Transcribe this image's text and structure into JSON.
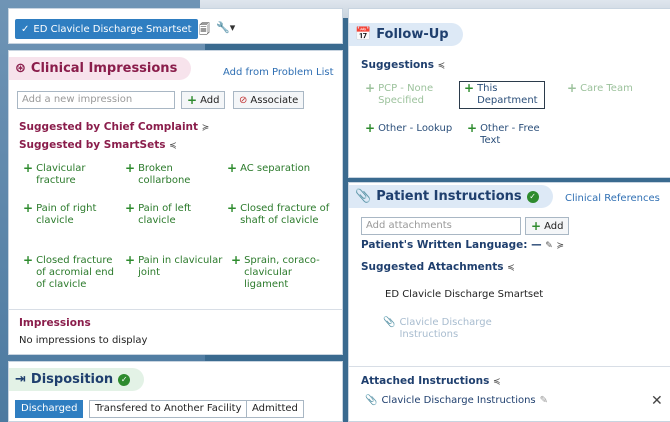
{
  "smartset": {
    "chip_label": "ED Clavicle Discharge Smartset",
    "check": "✓"
  },
  "clinical": {
    "title": "Clinical Impressions",
    "add_from_problem_list": "Add from Problem List",
    "input_placeholder": "Add a new impression",
    "add_label": "Add",
    "associate_label": "Associate",
    "suggested_cc": "Suggested by Chief Complaint",
    "suggested_smartsets": "Suggested by SmartSets",
    "suggestions": [
      "Clavicular fracture",
      "Broken collarbone",
      "AC separation",
      "Pain of right clavicle",
      "Pain of left clavicle",
      "Closed fracture of shaft of clavicle",
      "Closed fracture of acromial end of clavicle",
      "Pain in clavicular joint",
      "Sprain, coraco-clavicular ligament"
    ],
    "impressions_head": "Impressions",
    "no_impressions": "No impressions to display"
  },
  "disposition": {
    "title": "Disposition",
    "tabs": [
      "Discharged",
      "Transfered to Another Facility",
      "Admitted"
    ]
  },
  "followup": {
    "title": "Follow-Up",
    "suggestions_head": "Suggestions",
    "items": [
      "PCP - None Specified",
      "This Department",
      "Care Team",
      "Other - Lookup",
      "Other - Free Text"
    ]
  },
  "instructions": {
    "title": "Patient Instructions",
    "clinical_references": "Clinical References",
    "input_placeholder": "Add attachments",
    "add_label": "Add",
    "written_language": "Patient's Written Language: —",
    "suggested_attachments": "Suggested Attachments",
    "smartset_name": "ED Clavicle Discharge Smartset",
    "suggested_item": "Clavicle Discharge Instructions",
    "attached_head": "Attached Instructions",
    "attached_item": "Clavicle Discharge Instructions"
  },
  "colors": {
    "accent": "#2f7ec1",
    "green": "#2e8b2e",
    "maroon": "#8a1d4b",
    "navy": "#1f3f6e"
  }
}
